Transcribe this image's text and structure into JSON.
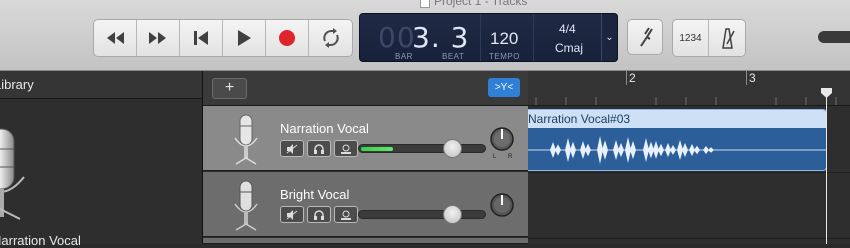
{
  "window": {
    "title": "Project 1 - Tracks"
  },
  "transport": {
    "rewind": "rewind-icon",
    "forward": "fast-forward-icon",
    "to_start": "go-to-beginning-icon",
    "play": "play-icon",
    "record": "record-icon",
    "cycle": "cycle-icon"
  },
  "lcd": {
    "bar_value": "00",
    "beat_value": "3. 3",
    "bar_label": "BAR",
    "beat_label": "BEAT",
    "tempo_value": "120",
    "tempo_label": "TEMPO",
    "time_signature": "4/4",
    "key": "Cmaj"
  },
  "toolbar_right": {
    "tuner": "tuning-fork-icon",
    "count_in": "1234",
    "metronome": "metronome-icon"
  },
  "library": {
    "title": "Library",
    "patch_name": "Narration Vocal"
  },
  "tracks_header": {
    "add_label": "+",
    "filter_label": ">Y<"
  },
  "tracks": [
    {
      "name": "Narration Vocal",
      "volume": 0.74,
      "meter_level": 0.25,
      "selected": true
    },
    {
      "name": "Bright Vocal",
      "volume": 0.74,
      "meter_level": 0,
      "selected": false
    }
  ],
  "ruler": {
    "bars": [
      "2",
      "3"
    ]
  },
  "region": {
    "name": "Narration Vocal#03",
    "color": "#2c5f9a"
  },
  "colors": {
    "accent": "#2f7fd6",
    "record": "#e0242c",
    "meter": "#39d04a"
  }
}
